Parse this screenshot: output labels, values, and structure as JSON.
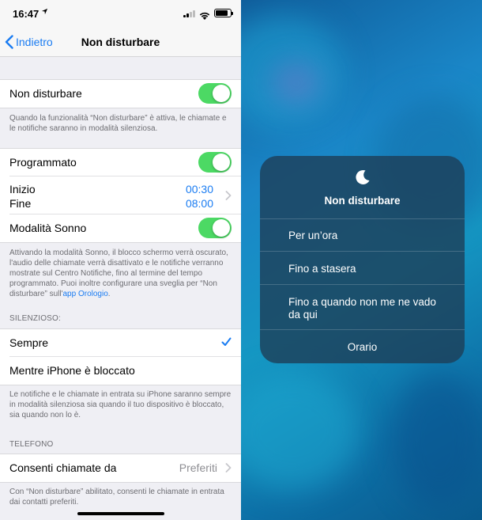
{
  "status": {
    "time": "16:47"
  },
  "nav": {
    "back_label": "Indietro",
    "title": "Non disturbare"
  },
  "dnd": {
    "label": "Non disturbare",
    "enabled": true,
    "footnote": "Quando la funzionalità “Non disturbare” è attiva, le chiamate e le notifiche saranno in modalità silenziosa."
  },
  "schedule": {
    "programmed_label": "Programmato",
    "start_label": "Inizio",
    "start_time": "00:30",
    "end_label": "Fine",
    "end_time": "08:00",
    "sleep_label": "Modalità Sonno",
    "sleep_footnote": "Attivando la modalità Sonno, il blocco schermo verrà oscurato, l'audio delle chiamate verrà disattivato e le notifiche verranno mostrate sul Centro Notifiche, fino al termine del tempo programmato. Puoi inoltre configurare una sveglia per “Non disturbare” sull'",
    "sleep_footnote_link": "app Orologio",
    "sleep_footnote_end": "."
  },
  "silence": {
    "header": "SILENZIOSO:",
    "always_label": "Sempre",
    "locked_label": "Mentre iPhone è bloccato",
    "footnote": "Le notifiche e le chiamate in entrata su iPhone saranno sempre in modalità silenziosa sia quando il tuo dispositivo è bloccato, sia quando non lo è."
  },
  "phone": {
    "header": "TELEFONO",
    "allow_calls_label": "Consenti chiamate da",
    "allow_calls_value": "Preferiti",
    "footnote": "Con “Non disturbare” abilitato, consenti le chiamate in entrata dai contatti preferiti."
  },
  "menu": {
    "title": "Non disturbare",
    "items": [
      "Per un’ora",
      "Fino a stasera",
      "Fino a quando non me ne vado da qui",
      "Orario"
    ]
  },
  "colors": {
    "accent": "#1a7cf2",
    "toggle_on": "#4cd964"
  }
}
